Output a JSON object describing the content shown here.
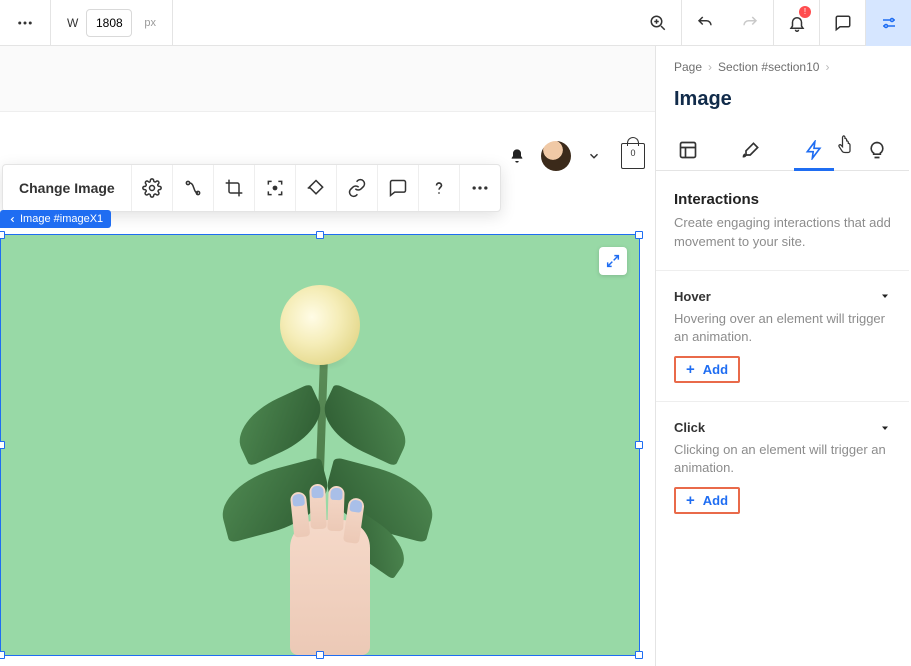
{
  "topbar": {
    "width_label": "W",
    "width_value": "1808",
    "width_unit": "px",
    "notif_badge": "!"
  },
  "context_toolbar": {
    "change_image": "Change Image"
  },
  "selection": {
    "tag": "Image #imageX1"
  },
  "chrome": {
    "bag_count": "0"
  },
  "panel": {
    "crumbs": {
      "page": "Page",
      "section": "Section #section10"
    },
    "title": "Image",
    "interactions": {
      "heading": "Interactions",
      "desc": "Create engaging interactions that add movement to your site."
    },
    "hover": {
      "title": "Hover",
      "desc": "Hovering over an element will trigger an animation.",
      "add": "Add"
    },
    "click": {
      "title": "Click",
      "desc": "Clicking on an element will trigger an animation.",
      "add": "Add"
    }
  }
}
